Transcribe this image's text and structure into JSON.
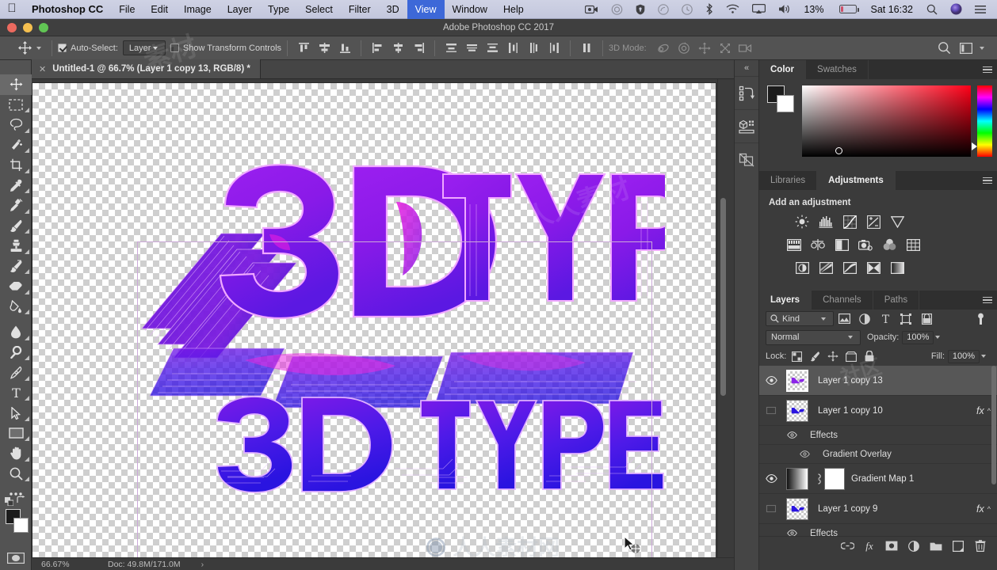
{
  "menubar": {
    "apple_icon": "apple-logo",
    "app_name": "Photoshop CC",
    "items": [
      "File",
      "Edit",
      "Image",
      "Layer",
      "Type",
      "Select",
      "Filter",
      "3D",
      "View",
      "Window",
      "Help"
    ],
    "active_item": "View",
    "status": {
      "battery_percent": "13%",
      "clock": "Sat 16:32",
      "icons": [
        "screen-record-icon",
        "creative-cloud-icon",
        "shield-icon",
        "airdrop-icon",
        "time-machine-icon",
        "bluetooth-icon",
        "wifi-icon",
        "airplay-icon",
        "volume-icon",
        "battery-icon",
        "spotlight-icon",
        "siri-icon",
        "notification-center-icon"
      ]
    }
  },
  "titlebar": {
    "app_window_title": "Adobe Photoshop CC 2017",
    "buttons": [
      "close",
      "minimize",
      "zoom"
    ]
  },
  "options_bar": {
    "tool_icon": "move-tool-icon",
    "auto_select_label": "Auto-Select:",
    "auto_select_checked": true,
    "auto_select_value": "Layer",
    "show_transform_label": "Show Transform Controls",
    "show_transform_checked": false,
    "align_icons": [
      "align-top-edges-icon",
      "align-vertical-centers-icon",
      "align-bottom-edges-icon",
      "align-left-edges-icon",
      "align-horizontal-centers-icon",
      "align-right-edges-icon"
    ],
    "distribute_icons": [
      "distribute-top-edges-icon",
      "distribute-vertical-centers-icon",
      "distribute-bottom-edges-icon",
      "distribute-left-edges-icon",
      "distribute-horizontal-centers-icon",
      "distribute-right-edges-icon",
      "distribute-spacing-icon"
    ],
    "mode_3d_label": "3D Mode:",
    "mode_3d_icons": [
      "rotate-3d-icon",
      "roll-3d-icon",
      "drag-3d-icon",
      "slide-3d-icon",
      "scale-3d-icon"
    ],
    "search_icon": "search-icon",
    "workspace_icon": "workspace-switcher-icon"
  },
  "document_tab": {
    "close_icon": "close-icon",
    "title": "Untitled-1 @ 66.7% (Layer 1 copy 13, RGB/8) *"
  },
  "toolbar": {
    "tools": [
      {
        "name": "move-tool",
        "active": true
      },
      {
        "name": "rectangular-marquee-tool",
        "active": false
      },
      {
        "name": "lasso-tool",
        "active": false
      },
      {
        "name": "quick-selection-tool",
        "active": false
      },
      {
        "name": "crop-tool",
        "active": false
      },
      {
        "name": "eyedropper-tool",
        "active": false
      },
      {
        "name": "spot-healing-brush-tool",
        "active": false
      },
      {
        "name": "brush-tool",
        "active": false
      },
      {
        "name": "clone-stamp-tool",
        "active": false
      },
      {
        "name": "history-brush-tool",
        "active": false
      },
      {
        "name": "eraser-tool",
        "active": false
      },
      {
        "name": "gradient-tool",
        "active": false
      },
      {
        "name": "blur-tool",
        "active": false
      },
      {
        "name": "dodge-tool",
        "active": false
      },
      {
        "name": "pen-tool",
        "active": false
      },
      {
        "name": "horizontal-type-tool",
        "active": false
      },
      {
        "name": "path-selection-tool",
        "active": false
      },
      {
        "name": "rectangle-tool",
        "active": false
      },
      {
        "name": "hand-tool",
        "active": false
      },
      {
        "name": "zoom-tool",
        "active": false
      },
      {
        "name": "edit-toolbar-tool",
        "active": false
      }
    ],
    "foreground_color": "#1c1c1c",
    "background_color": "#ffffff",
    "quick_mask_icon": "quick-mask-icon"
  },
  "canvas": {
    "artwork_title": "3D TYPE",
    "artwork_lines": [
      "3D",
      "TYPE",
      "3D",
      "TYPE"
    ],
    "transparent_background": true,
    "selection_visible": true,
    "cursor": "move-tool-cursor",
    "watermark": "人人素材网"
  },
  "status_bar": {
    "zoom": "66.67%",
    "doc_size": "Doc: 49.8M/171.0M",
    "arrow_icon": "chevron-right-icon"
  },
  "dock_strip": {
    "collapse_icon": "collapse-panels-icon",
    "icons": [
      "history-panel-icon",
      "3d-panel-icon",
      "properties-panel-icon"
    ]
  },
  "color_panel": {
    "tabs": [
      {
        "label": "Color",
        "active": true
      },
      {
        "label": "Swatches",
        "active": false
      }
    ],
    "menu_icon": "panel-menu-icon",
    "foreground_color": "#1c1c1c",
    "background_color": "#ffffff",
    "ramp": "rgb-hue-strip"
  },
  "adjustments_panel": {
    "tabs": [
      {
        "label": "Libraries",
        "active": false
      },
      {
        "label": "Adjustments",
        "active": true
      }
    ],
    "menu_icon": "panel-menu-icon",
    "heading": "Add an adjustment",
    "row1": [
      "brightness-contrast-icon",
      "levels-icon",
      "curves-icon",
      "exposure-icon",
      "vibrance-icon"
    ],
    "row2": [
      "hue-saturation-icon",
      "color-balance-icon",
      "black-white-icon",
      "photo-filter-icon",
      "channel-mixer-icon",
      "color-lookup-icon"
    ],
    "row3": [
      "invert-icon",
      "posterize-icon",
      "threshold-icon",
      "selective-color-icon",
      "gradient-map-icon"
    ]
  },
  "layers_panel": {
    "tabs": [
      {
        "label": "Layers",
        "active": true
      },
      {
        "label": "Channels",
        "active": false
      },
      {
        "label": "Paths",
        "active": false
      }
    ],
    "menu_icon": "panel-menu-icon",
    "filter": {
      "search_icon": "search-icon",
      "kind_label": "Kind",
      "type_icons": [
        "filter-pixel-icon",
        "filter-adjustment-icon",
        "filter-type-icon",
        "filter-shape-icon",
        "filter-smart-object-icon"
      ],
      "toggle_icon": "filter-toggle-icon"
    },
    "blend_mode": "Normal",
    "opacity_label": "Opacity:",
    "opacity_value": "100%",
    "lock_label": "Lock:",
    "lock_icons": [
      "lock-transparent-pixels-icon",
      "lock-image-pixels-icon",
      "lock-position-icon",
      "lock-artboard-nesting-icon",
      "lock-all-icon"
    ],
    "fill_label": "Fill:",
    "fill_value": "100%",
    "layers": [
      {
        "name": "Layer 1 copy 13",
        "visible": true,
        "selected": true,
        "thumb": "pixel-art-thumb",
        "has_fx": false
      },
      {
        "name": "Layer 1 copy 10",
        "visible": false,
        "selected": false,
        "thumb": "pixel-art-thumb",
        "has_fx": true,
        "fx_label": "fx",
        "children": [
          {
            "name": "Effects",
            "visible": true,
            "indent": 1
          },
          {
            "name": "Gradient Overlay",
            "visible": true,
            "indent": 2
          }
        ]
      },
      {
        "name": "Gradient Map 1",
        "visible": true,
        "selected": false,
        "thumb": "gradient-map-thumb",
        "has_mask": true,
        "has_fx": false
      },
      {
        "name": "Layer 1 copy 9",
        "visible": false,
        "selected": false,
        "thumb": "pixel-art-thumb",
        "has_fx": true,
        "fx_label": "fx",
        "children": [
          {
            "name": "Effects",
            "visible": true,
            "indent": 1
          }
        ]
      }
    ],
    "footer_icons": [
      "link-layers-icon",
      "add-layer-style-icon",
      "add-layer-mask-icon",
      "new-adjustment-layer-icon",
      "new-group-icon",
      "new-layer-icon",
      "delete-layer-icon"
    ]
  },
  "colors": {
    "chrome_bg": "#3b3b3b",
    "panel_bg": "#454545",
    "options_bg": "#535353",
    "selected_row": "#575757",
    "menubar_bg": "#c9cce0",
    "menubar_active": "#3d68d8",
    "artwork_purple": "#8b25e8",
    "artwork_magenta": "#e01ce8",
    "artwork_blue": "#3318e8",
    "selection_outline": "#cba8d8"
  }
}
